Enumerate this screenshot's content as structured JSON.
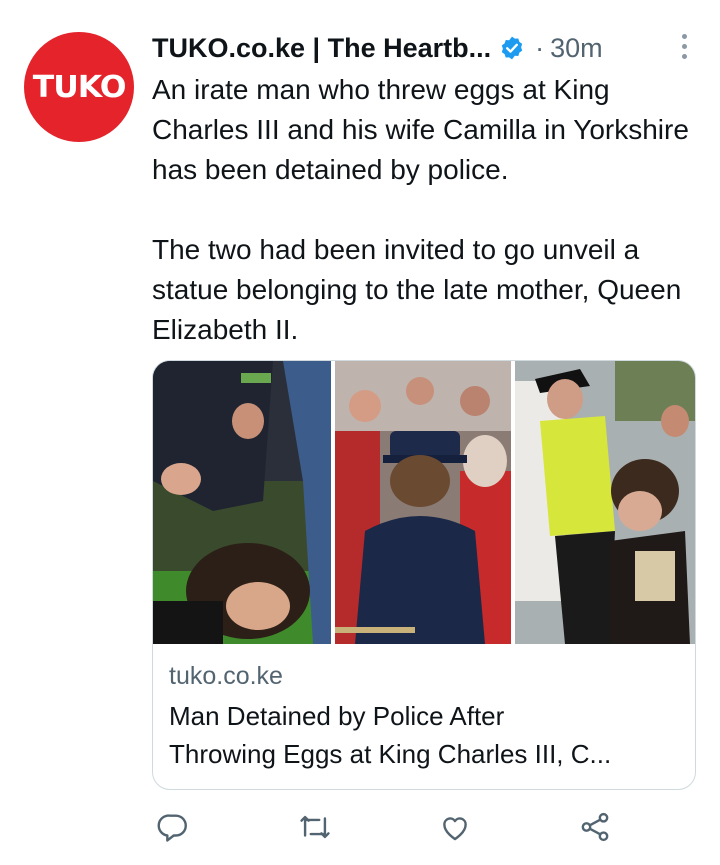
{
  "avatar": {
    "text": "TUKO",
    "color": "#e4232b"
  },
  "header": {
    "author": "TUKO.co.ke | The Heartb...",
    "verified_icon": "verified-badge-icon",
    "separator": "·",
    "time": "30m",
    "more_icon": "more-vertical-icon"
  },
  "tweet": {
    "paragraphs": [
      "An irate man who threw eggs at King Charles III and his wife Camilla in Yorkshire has been detained by police.",
      "The two had been invited to go unveil a statue belonging to the late mother, Queen Elizabeth II."
    ]
  },
  "card": {
    "images": [
      "man-pinned-by-police-photo",
      "royal-crowd-photo",
      "man-detained-by-officer-photo"
    ],
    "domain": "tuko.co.ke",
    "title_line1": "Man Detained by Police After",
    "title_line2": "Throwing Eggs at King Charles III, C..."
  },
  "actions": {
    "icons": [
      "reply-icon",
      "retweet-icon",
      "like-icon",
      "share-icon"
    ]
  },
  "colors": {
    "accent": "#1d9bf0",
    "muted": "#536471",
    "border": "#cfd9de"
  }
}
